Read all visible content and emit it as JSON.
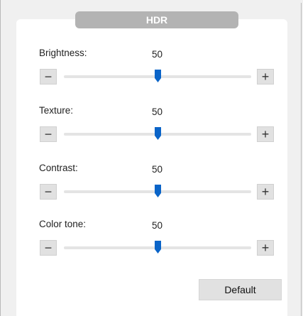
{
  "header": {
    "title": "HDR"
  },
  "sliders": [
    {
      "label": "Brightness:",
      "value": "50",
      "level": 0.5,
      "minus": "−",
      "plus": "+"
    },
    {
      "label": "Texture:",
      "value": "50",
      "level": 0.5,
      "minus": "−",
      "plus": "+"
    },
    {
      "label": "Contrast:",
      "value": "50",
      "level": 0.5,
      "minus": "−",
      "plus": "+"
    },
    {
      "label": "Color tone:",
      "value": "50",
      "level": 0.5,
      "minus": "−",
      "plus": "+"
    }
  ],
  "footer": {
    "default_label": "Default"
  },
  "colors": {
    "accent": "#0a64c8",
    "tab": "#b3b3b3"
  }
}
